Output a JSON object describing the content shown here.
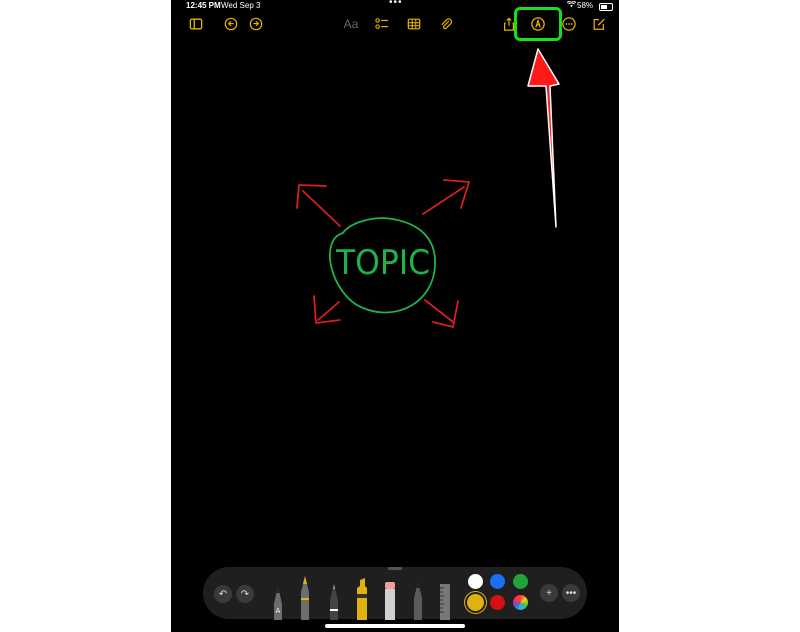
{
  "status_bar": {
    "time": "12:45 PM",
    "date": "Wed Sep 3",
    "battery": "58%"
  },
  "toolbar": {
    "format_label": "Aa",
    "left_icons": [
      "sidebar-icon",
      "undo-icon",
      "redo-icon"
    ],
    "center_icons": [
      "checklist-icon",
      "table-icon",
      "attachment-icon"
    ],
    "right_icons": [
      "share-icon",
      "markup-icon",
      "more-icon",
      "compose-icon"
    ]
  },
  "canvas": {
    "topic_text": "TOPIC",
    "circle_color": "#1db34a",
    "arrow_color": "#d81e1e"
  },
  "annotation": {
    "highlight_color": "#18e018",
    "arrow_color": "#ff1a1a"
  },
  "palette": {
    "tools": [
      "monoline-pen",
      "fountain-pen",
      "marker",
      "highlighter",
      "eraser",
      "pencil",
      "ruler"
    ],
    "colors": [
      "#ffffff",
      "#1a6ff2",
      "#21a33a",
      "#e0b20f",
      "#d60f14",
      "multicolor"
    ],
    "selected_color": "#e0b20f"
  }
}
